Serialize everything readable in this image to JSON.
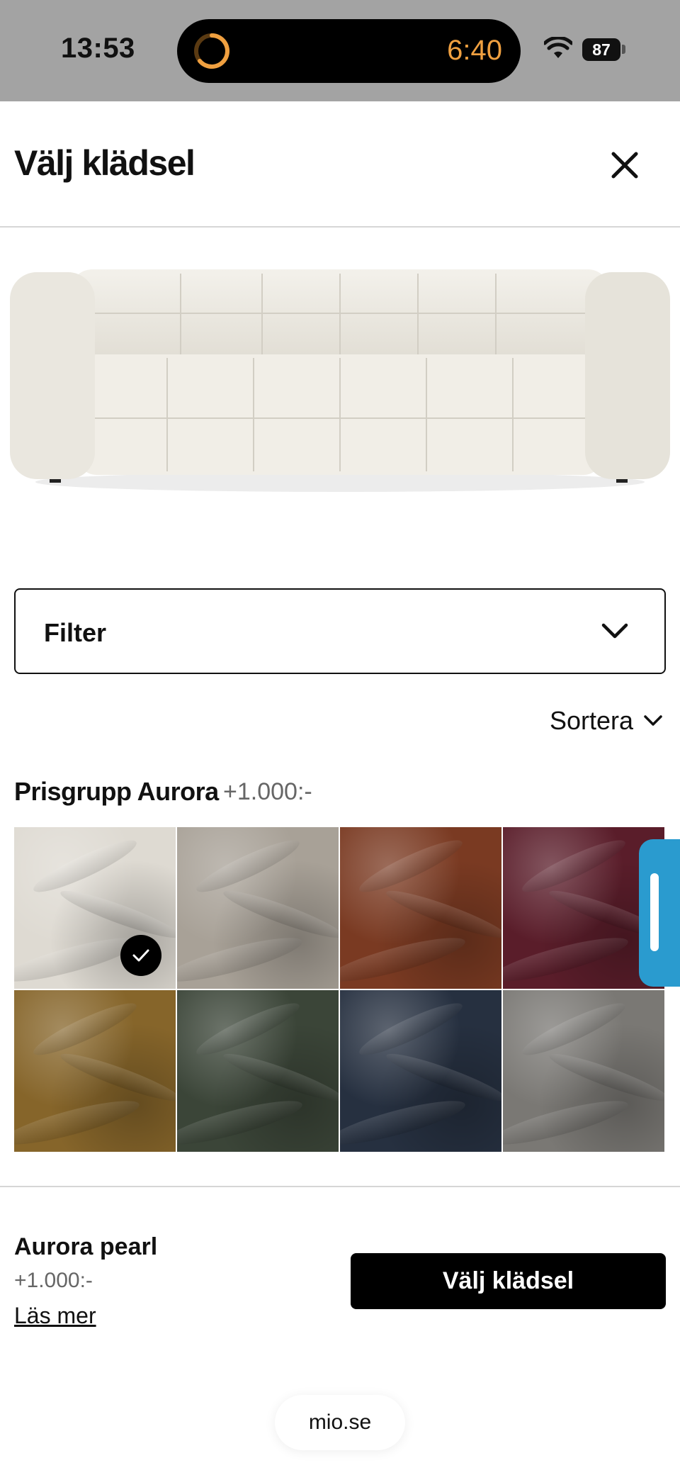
{
  "status_bar": {
    "time": "13:53",
    "timer": "6:40",
    "battery": "87"
  },
  "header": {
    "title": "Välj klädsel"
  },
  "filter": {
    "label": "Filter"
  },
  "sort": {
    "label": "Sortera"
  },
  "group": {
    "title": "Prisgrupp Aurora",
    "price": "+1.000:-"
  },
  "swatches": [
    {
      "color": "#dedad2",
      "selected": true
    },
    {
      "color": "#a8a197",
      "selected": false
    },
    {
      "color": "#7a3a22",
      "selected": false
    },
    {
      "color": "#5a1d2a",
      "selected": false
    },
    {
      "color": "#86652a",
      "selected": false
    },
    {
      "color": "#3b4538",
      "selected": false
    },
    {
      "color": "#263040",
      "selected": false
    },
    {
      "color": "#7a7874",
      "selected": false
    }
  ],
  "selection": {
    "name": "Aurora pearl",
    "price": "+1.000:-",
    "read_more": "Läs mer",
    "button": "Välj klädsel"
  },
  "url": "mio.se",
  "colors": {
    "accent_handle": "#2a9bcf",
    "timer_orange": "#f0a040",
    "sofa": "#ece9e1"
  }
}
